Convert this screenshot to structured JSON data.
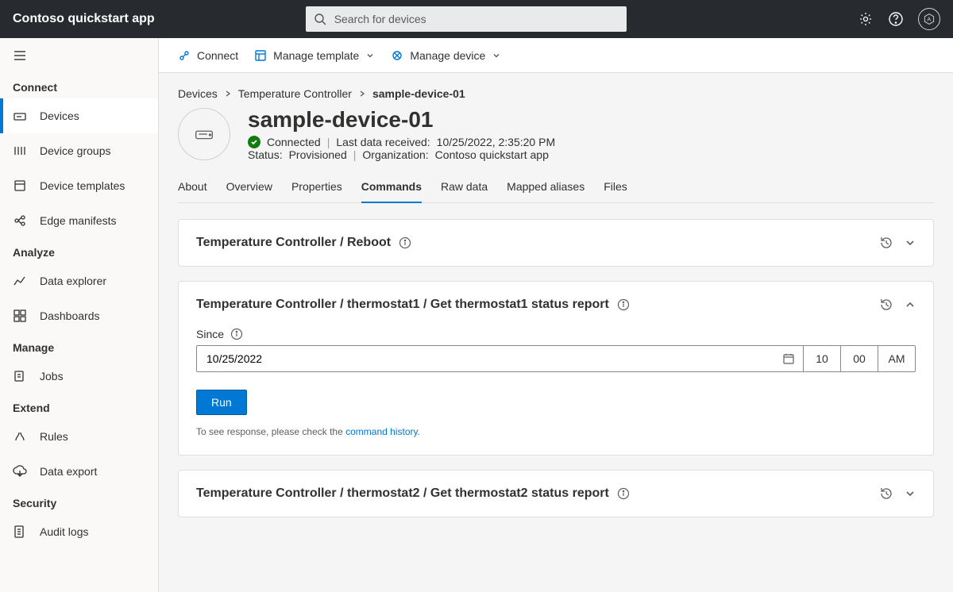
{
  "header": {
    "app_title": "Contoso quickstart app",
    "search_placeholder": "Search for devices",
    "avatar_initials": "A"
  },
  "sidebar": {
    "groups": [
      {
        "label": "Connect",
        "items": [
          {
            "label": "Devices",
            "selected": true,
            "icon": "devices"
          },
          {
            "label": "Device groups",
            "icon": "groups"
          },
          {
            "label": "Device templates",
            "icon": "templates"
          },
          {
            "label": "Edge manifests",
            "icon": "edge"
          }
        ]
      },
      {
        "label": "Analyze",
        "items": [
          {
            "label": "Data explorer",
            "icon": "explorer"
          },
          {
            "label": "Dashboards",
            "icon": "dashboards"
          }
        ]
      },
      {
        "label": "Manage",
        "items": [
          {
            "label": "Jobs",
            "icon": "jobs"
          }
        ]
      },
      {
        "label": "Extend",
        "items": [
          {
            "label": "Rules",
            "icon": "rules"
          },
          {
            "label": "Data export",
            "icon": "export"
          }
        ]
      },
      {
        "label": "Security",
        "items": [
          {
            "label": "Audit logs",
            "icon": "audit"
          }
        ]
      }
    ]
  },
  "toolbar": {
    "connect": "Connect",
    "manage_template": "Manage template",
    "manage_device": "Manage device"
  },
  "breadcrumb": {
    "a": "Devices",
    "b": "Temperature Controller",
    "c": "sample-device-01"
  },
  "page": {
    "title": "sample-device-01",
    "connected": "Connected",
    "last_data_label": "Last data received:",
    "last_data_value": "10/25/2022, 2:35:20 PM",
    "status_label": "Status:",
    "status_value": "Provisioned",
    "org_label": "Organization:",
    "org_value": "Contoso quickstart app"
  },
  "tabs": {
    "about": "About",
    "overview": "Overview",
    "properties": "Properties",
    "commands": "Commands",
    "raw": "Raw data",
    "mapped": "Mapped aliases",
    "files": "Files",
    "active": "commands"
  },
  "commands": [
    {
      "title": "Temperature Controller / Reboot",
      "expanded": false
    },
    {
      "title": "Temperature Controller / thermostat1 / Get thermostat1 status report",
      "expanded": true,
      "since_label": "Since",
      "date_value": "10/25/2022",
      "hour": "10",
      "minute": "00",
      "ampm": "AM",
      "run_label": "Run",
      "hint_prefix": "To see response, please check the ",
      "hint_link": "command history",
      "hint_suffix": "."
    },
    {
      "title": "Temperature Controller / thermostat2 / Get thermostat2 status report",
      "expanded": false
    }
  ]
}
